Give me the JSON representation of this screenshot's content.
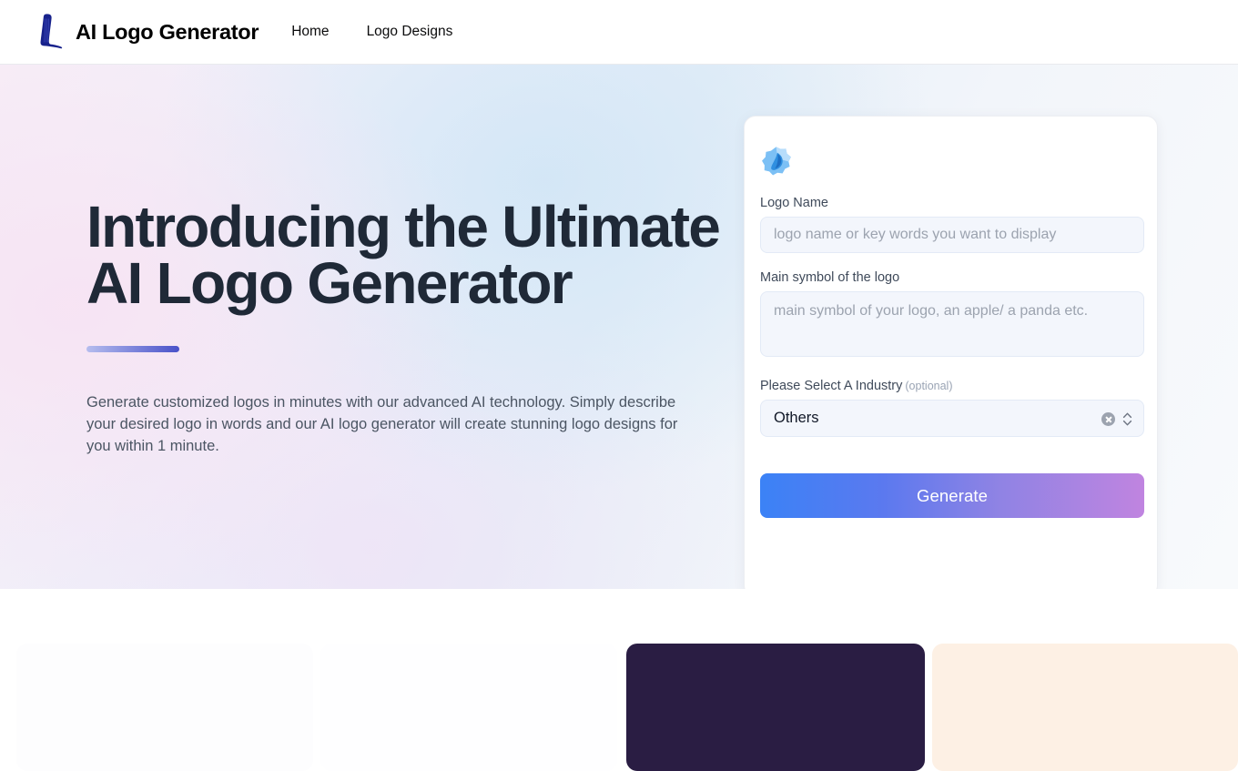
{
  "header": {
    "brand_name": "AI Logo Generator",
    "logo_icon": "stylized-l-logo-icon",
    "nav": [
      {
        "label": "Home",
        "name": "nav-link-home"
      },
      {
        "label": "Logo Designs",
        "name": "nav-link-logo-designs"
      }
    ]
  },
  "hero": {
    "heading_line1": "Introducing the Ultimate",
    "heading_line2": "AI Logo Generator",
    "paragraph": "Generate customized logos in minutes with our advanced AI technology. Simply describe your desired logo in words and our AI logo generator will create stunning logo designs for you within 1 minute.",
    "accent_bar_colors": [
      "#b6bdee",
      "#4951c9"
    ]
  },
  "form": {
    "card_icon": "blue-gem-icon",
    "logo_name": {
      "label": "Logo Name",
      "placeholder": "logo name or key words you want to display",
      "value": ""
    },
    "main_symbol": {
      "label": "Main symbol of the logo",
      "placeholder": "main symbol of your logo, an apple/ a panda etc.",
      "value": ""
    },
    "industry": {
      "label": "Please Select A Industry",
      "optional_tag": "(optional)",
      "selected": "Others",
      "clear_icon": "clear-circle-x-icon",
      "stepper_icon": "chevron-up-down-icon"
    },
    "generate_label": "Generate",
    "generate_gradient": [
      "#3b82f6",
      "#c084e0"
    ]
  },
  "below": {
    "panels": [
      {
        "name": "preview-panel-1",
        "color": "#fdfdfe"
      },
      {
        "name": "preview-panel-2",
        "color": "#fefeff"
      },
      {
        "name": "preview-panel-dark",
        "color": "#2a1d43"
      },
      {
        "name": "preview-panel-cream",
        "color": "#fdf0e4"
      }
    ]
  }
}
